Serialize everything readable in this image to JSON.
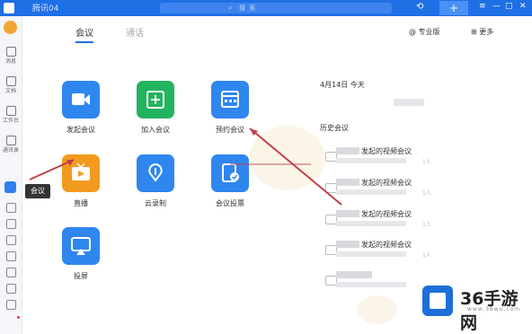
{
  "titlebar": {
    "app_name": "腾讯04",
    "search_icon": "search-icon",
    "search_placeholder": "搜 索",
    "history_icon": "history-icon",
    "plus_label": "+",
    "win_menu": "≡",
    "win_min": "—",
    "win_max": "□",
    "win_close": "✕"
  },
  "tabs": [
    {
      "label": "会议"
    },
    {
      "label": "通话"
    }
  ],
  "topright": {
    "personal_meeting": "@ 专业版",
    "more": "⊞ 更多"
  },
  "tiles": [
    {
      "label": "发起会议",
      "color": "#2f86ef",
      "icon": "video-camera-icon"
    },
    {
      "label": "加入会议",
      "color": "#22b35e",
      "icon": "plus-icon"
    },
    {
      "label": "预约会议",
      "color": "#2f86ef",
      "icon": "calendar-icon"
    },
    {
      "label": "直播",
      "color": "#f29a1f",
      "icon": "tv-play-icon"
    },
    {
      "label": "云录制",
      "color": "#2f86ef",
      "icon": "cloud-record-icon"
    },
    {
      "label": "会议投票",
      "color": "#2f86ef",
      "icon": "vote-icon"
    },
    {
      "label": "投屏",
      "color": "#2f86ef",
      "icon": "screen-cast-icon"
    }
  ],
  "side": {
    "date": "4月14日 今天",
    "history_title": "历史会议"
  },
  "history": [
    {
      "title": "发起的视频会议",
      "count": "1人"
    },
    {
      "title": "发起的视频会议",
      "count": "1人"
    },
    {
      "title": "发起的视频会议",
      "count": "1人"
    },
    {
      "title": "发起的视频会议",
      "count": "1人"
    },
    {
      "title": "",
      "count": ""
    }
  ],
  "leftnav": [
    {
      "label": "消息"
    },
    {
      "label": "文档"
    },
    {
      "label": "工作台"
    },
    {
      "label": "通讯录"
    }
  ],
  "tooltip": "会议",
  "watermark": {
    "brand": "36手游网",
    "url": "www.36wu.com"
  }
}
